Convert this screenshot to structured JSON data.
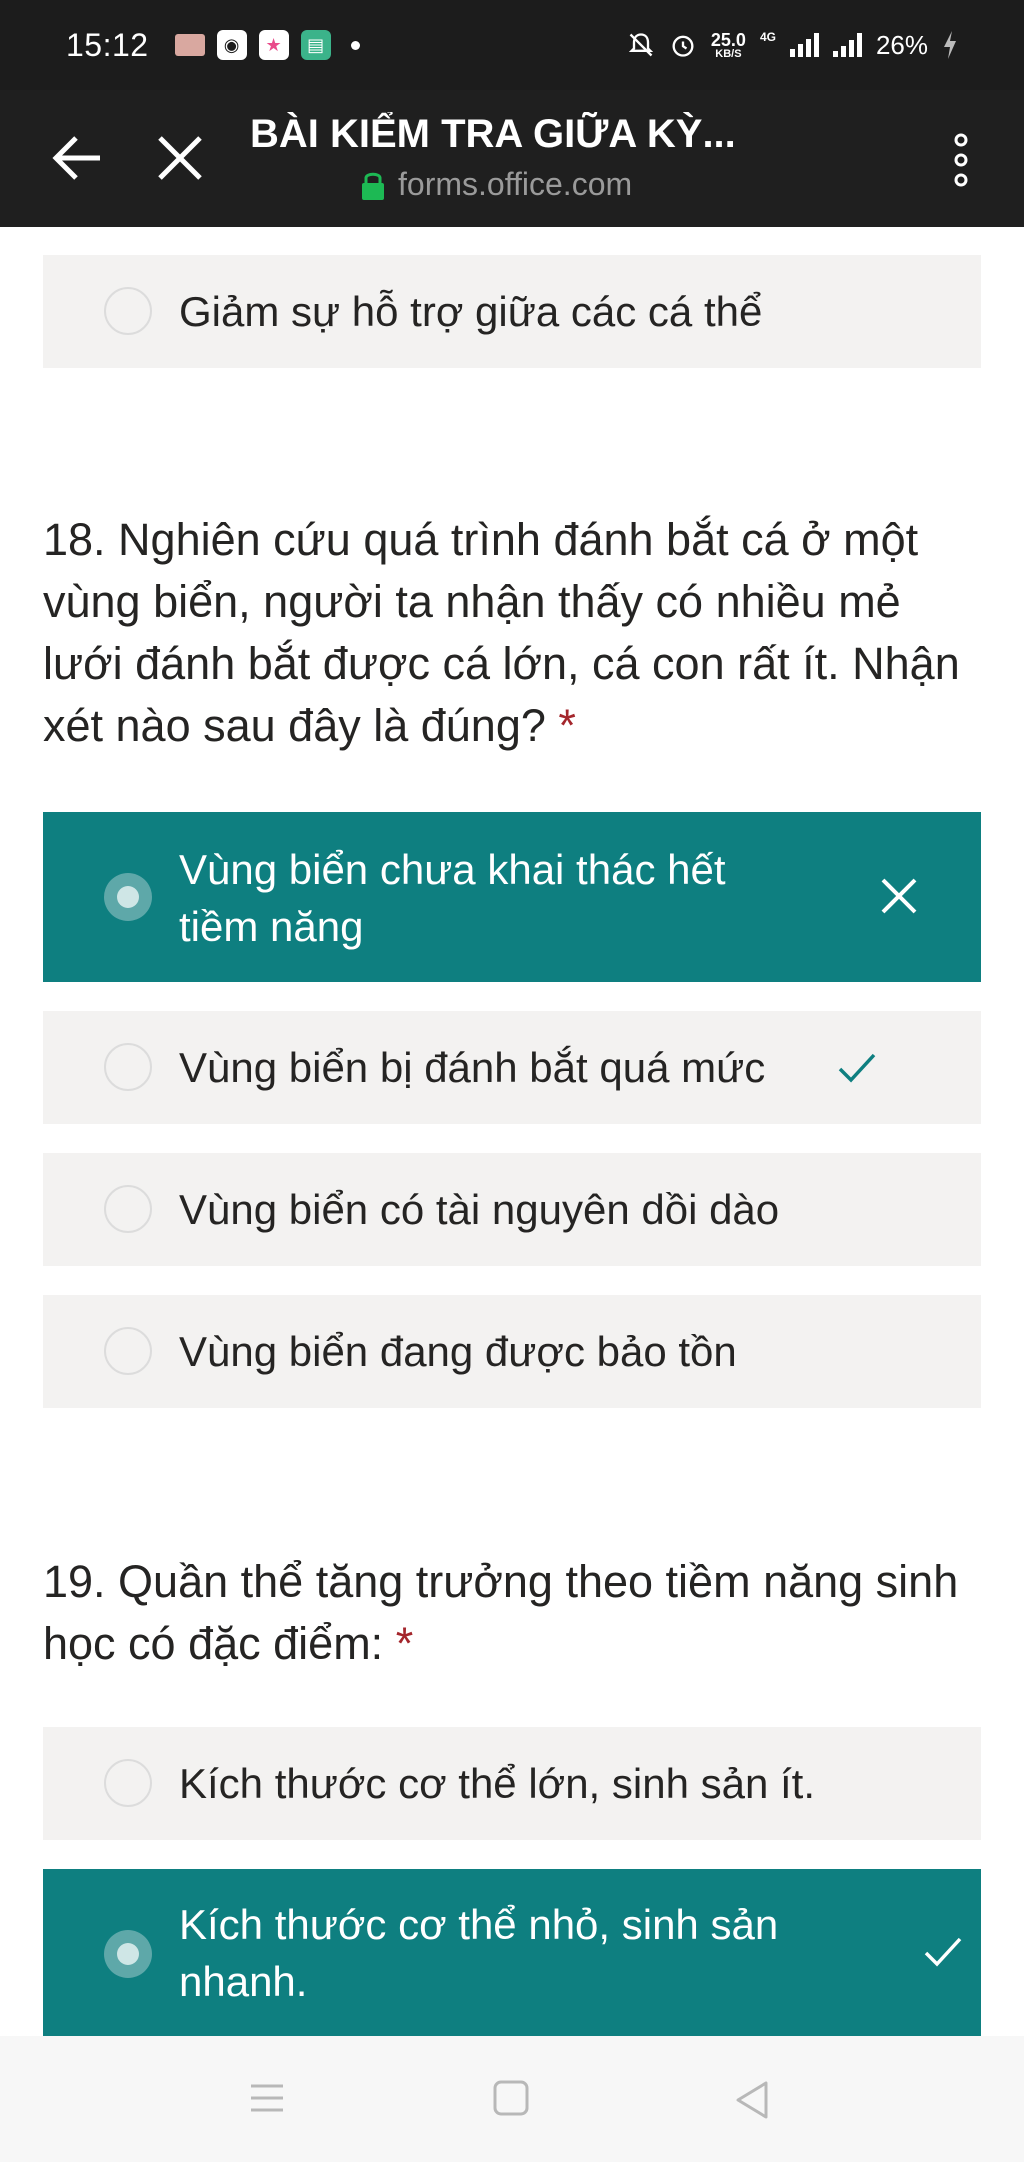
{
  "status_bar": {
    "time": "15:12",
    "speed_value": "25.0",
    "speed_unit": "KB/S",
    "network": "4G",
    "battery": "26%"
  },
  "app_bar": {
    "title": "BÀI KIỂM TRA GIỮA KỲ...",
    "url": "forms.office.com"
  },
  "q17": {
    "choices": [
      {
        "label": "Giảm sự hỗ trợ giữa các cá thể",
        "selected": false
      }
    ]
  },
  "q18": {
    "question": "18. Nghiên cứu quá trình đánh bắt cá ở một vùng biển, người ta nhận thấy có nhiều mẻ lưới đánh bắt được cá lớn, cá con rất ít. Nhận xét nào sau đây là đúng?",
    "required_mark": "*",
    "choices": [
      {
        "label": "Vùng biển chưa khai thác hết tiềm năng",
        "selected": true,
        "mark": "wrong"
      },
      {
        "label": "Vùng biển bị đánh bắt quá mức",
        "selected": false,
        "mark": "correct"
      },
      {
        "label": "Vùng biển có tài nguyên dồi dào",
        "selected": false,
        "mark": ""
      },
      {
        "label": "Vùng biển đang được bảo tồn",
        "selected": false,
        "mark": ""
      }
    ]
  },
  "q19": {
    "question": "19. Quần thể tăng trưởng theo tiềm năng sinh học có đặc điểm:",
    "required_mark": "*",
    "choices": [
      {
        "label": "Kích thước cơ thể lớn, sinh sản ít.",
        "selected": false,
        "mark": ""
      },
      {
        "label": "Kích thước cơ thể nhỏ, sinh sản nhanh.",
        "selected": true,
        "mark": "correct"
      }
    ]
  },
  "colors": {
    "accent": "#0e7f80",
    "choice_bg": "#f3f2f1",
    "required": "#a4262c",
    "correct_mark": "#0e7f80"
  },
  "icons": [
    "back-arrow-icon",
    "close-icon",
    "lock-icon",
    "more-vert-icon",
    "close-mark-icon",
    "check-mark-icon",
    "nav-menu-icon",
    "nav-home-icon",
    "nav-back-icon"
  ]
}
